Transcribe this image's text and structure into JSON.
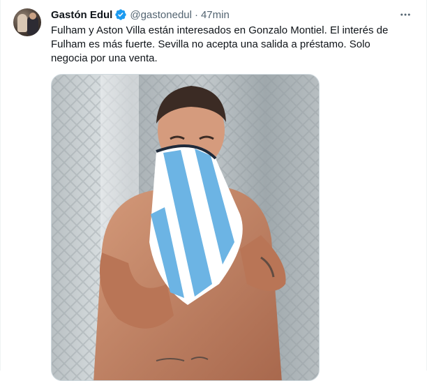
{
  "tweet": {
    "author_name": "Gastón Edul",
    "handle": "@gastonedul",
    "separator": "·",
    "time": "47min",
    "text": "Fulham y Aston Villa están interesados en Gonzalo Montiel. El interés de\nFulham es más fuerte. Sevilla no acepta una salida a préstamo. Solo\nnegocia por una venta."
  },
  "icons": {
    "verified": "verified-badge-icon",
    "more": "more-options-icon"
  },
  "colors": {
    "text": "#0f1419",
    "secondary": "#536471",
    "verified": "#1d9bf0",
    "border": "#cfd9de"
  }
}
